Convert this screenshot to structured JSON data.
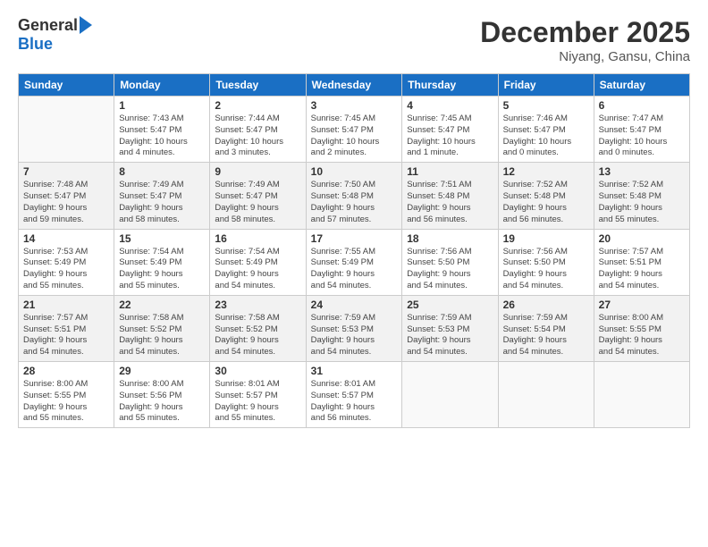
{
  "logo": {
    "general": "General",
    "blue": "Blue"
  },
  "title": "December 2025",
  "location": "Niyang, Gansu, China",
  "weekdays": [
    "Sunday",
    "Monday",
    "Tuesday",
    "Wednesday",
    "Thursday",
    "Friday",
    "Saturday"
  ],
  "weeks": [
    [
      {
        "day": "",
        "info": ""
      },
      {
        "day": "1",
        "info": "Sunrise: 7:43 AM\nSunset: 5:47 PM\nDaylight: 10 hours\nand 4 minutes."
      },
      {
        "day": "2",
        "info": "Sunrise: 7:44 AM\nSunset: 5:47 PM\nDaylight: 10 hours\nand 3 minutes."
      },
      {
        "day": "3",
        "info": "Sunrise: 7:45 AM\nSunset: 5:47 PM\nDaylight: 10 hours\nand 2 minutes."
      },
      {
        "day": "4",
        "info": "Sunrise: 7:45 AM\nSunset: 5:47 PM\nDaylight: 10 hours\nand 1 minute."
      },
      {
        "day": "5",
        "info": "Sunrise: 7:46 AM\nSunset: 5:47 PM\nDaylight: 10 hours\nand 0 minutes."
      },
      {
        "day": "6",
        "info": "Sunrise: 7:47 AM\nSunset: 5:47 PM\nDaylight: 10 hours\nand 0 minutes."
      }
    ],
    [
      {
        "day": "7",
        "info": "Sunrise: 7:48 AM\nSunset: 5:47 PM\nDaylight: 9 hours\nand 59 minutes."
      },
      {
        "day": "8",
        "info": "Sunrise: 7:49 AM\nSunset: 5:47 PM\nDaylight: 9 hours\nand 58 minutes."
      },
      {
        "day": "9",
        "info": "Sunrise: 7:49 AM\nSunset: 5:47 PM\nDaylight: 9 hours\nand 58 minutes."
      },
      {
        "day": "10",
        "info": "Sunrise: 7:50 AM\nSunset: 5:48 PM\nDaylight: 9 hours\nand 57 minutes."
      },
      {
        "day": "11",
        "info": "Sunrise: 7:51 AM\nSunset: 5:48 PM\nDaylight: 9 hours\nand 56 minutes."
      },
      {
        "day": "12",
        "info": "Sunrise: 7:52 AM\nSunset: 5:48 PM\nDaylight: 9 hours\nand 56 minutes."
      },
      {
        "day": "13",
        "info": "Sunrise: 7:52 AM\nSunset: 5:48 PM\nDaylight: 9 hours\nand 55 minutes."
      }
    ],
    [
      {
        "day": "14",
        "info": "Sunrise: 7:53 AM\nSunset: 5:49 PM\nDaylight: 9 hours\nand 55 minutes."
      },
      {
        "day": "15",
        "info": "Sunrise: 7:54 AM\nSunset: 5:49 PM\nDaylight: 9 hours\nand 55 minutes."
      },
      {
        "day": "16",
        "info": "Sunrise: 7:54 AM\nSunset: 5:49 PM\nDaylight: 9 hours\nand 54 minutes."
      },
      {
        "day": "17",
        "info": "Sunrise: 7:55 AM\nSunset: 5:49 PM\nDaylight: 9 hours\nand 54 minutes."
      },
      {
        "day": "18",
        "info": "Sunrise: 7:56 AM\nSunset: 5:50 PM\nDaylight: 9 hours\nand 54 minutes."
      },
      {
        "day": "19",
        "info": "Sunrise: 7:56 AM\nSunset: 5:50 PM\nDaylight: 9 hours\nand 54 minutes."
      },
      {
        "day": "20",
        "info": "Sunrise: 7:57 AM\nSunset: 5:51 PM\nDaylight: 9 hours\nand 54 minutes."
      }
    ],
    [
      {
        "day": "21",
        "info": "Sunrise: 7:57 AM\nSunset: 5:51 PM\nDaylight: 9 hours\nand 54 minutes."
      },
      {
        "day": "22",
        "info": "Sunrise: 7:58 AM\nSunset: 5:52 PM\nDaylight: 9 hours\nand 54 minutes."
      },
      {
        "day": "23",
        "info": "Sunrise: 7:58 AM\nSunset: 5:52 PM\nDaylight: 9 hours\nand 54 minutes."
      },
      {
        "day": "24",
        "info": "Sunrise: 7:59 AM\nSunset: 5:53 PM\nDaylight: 9 hours\nand 54 minutes."
      },
      {
        "day": "25",
        "info": "Sunrise: 7:59 AM\nSunset: 5:53 PM\nDaylight: 9 hours\nand 54 minutes."
      },
      {
        "day": "26",
        "info": "Sunrise: 7:59 AM\nSunset: 5:54 PM\nDaylight: 9 hours\nand 54 minutes."
      },
      {
        "day": "27",
        "info": "Sunrise: 8:00 AM\nSunset: 5:55 PM\nDaylight: 9 hours\nand 54 minutes."
      }
    ],
    [
      {
        "day": "28",
        "info": "Sunrise: 8:00 AM\nSunset: 5:55 PM\nDaylight: 9 hours\nand 55 minutes."
      },
      {
        "day": "29",
        "info": "Sunrise: 8:00 AM\nSunset: 5:56 PM\nDaylight: 9 hours\nand 55 minutes."
      },
      {
        "day": "30",
        "info": "Sunrise: 8:01 AM\nSunset: 5:57 PM\nDaylight: 9 hours\nand 55 minutes."
      },
      {
        "day": "31",
        "info": "Sunrise: 8:01 AM\nSunset: 5:57 PM\nDaylight: 9 hours\nand 56 minutes."
      },
      {
        "day": "",
        "info": ""
      },
      {
        "day": "",
        "info": ""
      },
      {
        "day": "",
        "info": ""
      }
    ]
  ]
}
